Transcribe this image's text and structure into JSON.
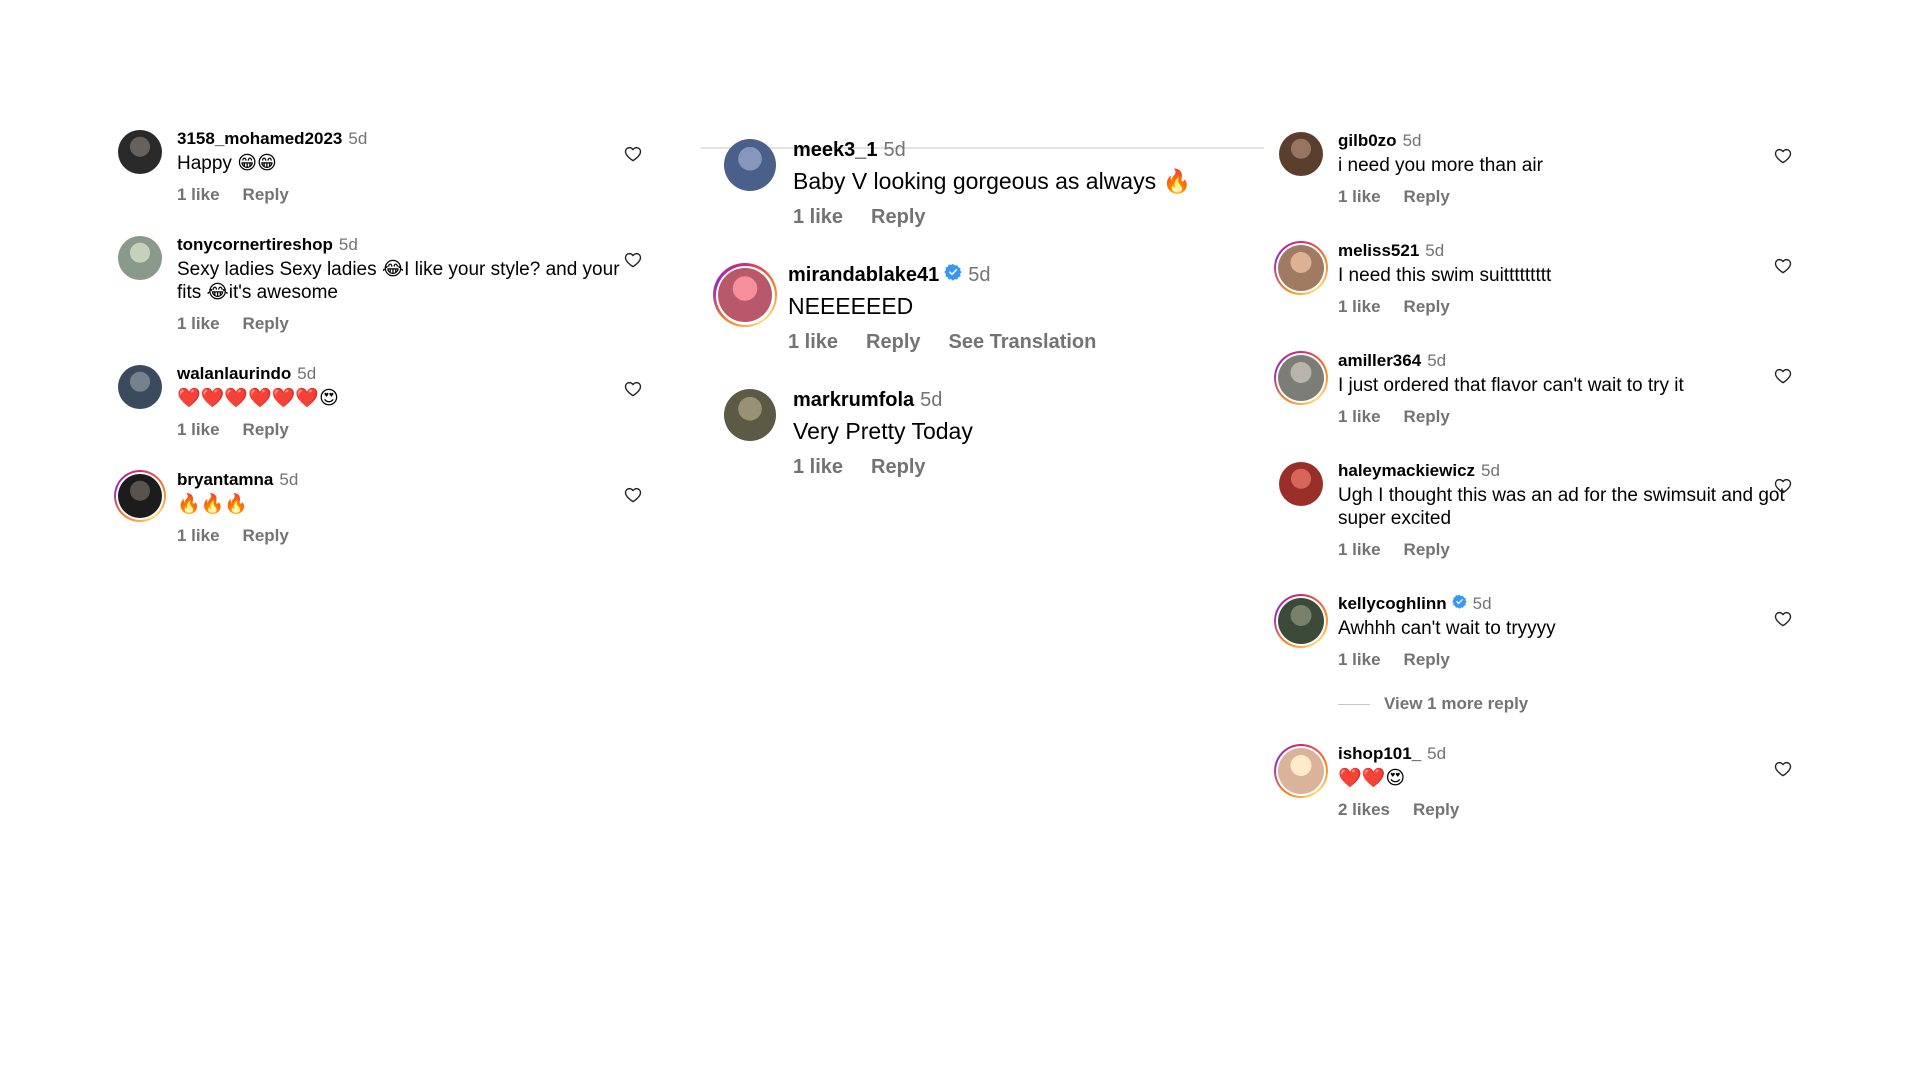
{
  "columns": [
    {
      "comments": [
        {
          "user": "3158_mohamed2023",
          "time": "5d",
          "text": "Happy 😁😁",
          "likes": "1 like",
          "reply": "Reply",
          "verified": false,
          "story": false,
          "avatar_color": "#2a2a2a"
        },
        {
          "user": "tonycornertireshop",
          "time": "5d",
          "text": "Sexy ladies Sexy ladies 😂I like your style? and your fits 😂it's awesome",
          "likes": "1 like",
          "reply": "Reply",
          "verified": false,
          "story": false,
          "avatar_color": "#8a9a8a"
        },
        {
          "user": "walanlaurindo",
          "time": "5d",
          "text": "❤️❤️❤️❤️❤️❤️😍",
          "likes": "1 like",
          "reply": "Reply",
          "verified": false,
          "story": false,
          "avatar_color": "#3b4a5c"
        },
        {
          "user": "bryantamna",
          "time": "5d",
          "text": "🔥🔥🔥",
          "likes": "1 like",
          "reply": "Reply",
          "verified": false,
          "story": true,
          "avatar_color": "#1c1c1c"
        }
      ]
    },
    {
      "comments": [
        {
          "user": "meek3_1",
          "time": "5d",
          "text": "Baby V looking gorgeous as always 🔥",
          "likes": "1 like",
          "reply": "Reply",
          "verified": false,
          "story": false,
          "avatar_color": "#4a5f8a"
        },
        {
          "user": "mirandablake41",
          "time": "5d",
          "text": "NEEEEEED",
          "likes": "1 like",
          "reply": "Reply",
          "translate": "See Translation",
          "verified": true,
          "story": true,
          "avatar_color": "#b9586a"
        },
        {
          "user": "markrumfola",
          "time": "5d",
          "text": "Very Pretty Today",
          "likes": "1 like",
          "reply": "Reply",
          "verified": false,
          "story": false,
          "avatar_color": "#5c5a44"
        }
      ]
    },
    {
      "comments": [
        {
          "user": "gilb0zo",
          "time": "5d",
          "text": "i need you more than air",
          "likes": "1 like",
          "reply": "Reply",
          "verified": false,
          "story": false,
          "avatar_color": "#5a3f2e"
        },
        {
          "user": "meliss521",
          "time": "5d",
          "text": "I need this swim suittttttttt",
          "likes": "1 like",
          "reply": "Reply",
          "verified": false,
          "story": true,
          "avatar_color": "#a07a62"
        },
        {
          "user": "amiller364",
          "time": "5d",
          "text": "I just ordered that flavor can't wait to try it",
          "likes": "1 like",
          "reply": "Reply",
          "verified": false,
          "story": true,
          "avatar_color": "#7d7d78"
        },
        {
          "user": "haleymackiewicz",
          "time": "5d",
          "text": "Ugh I thought this was an ad for the swimsuit and got super excited",
          "likes": "1 like",
          "reply": "Reply",
          "verified": false,
          "story": false,
          "avatar_color": "#9a2f2a"
        },
        {
          "user": "kellycoghlinn",
          "time": "5d",
          "text": "Awhhh can't wait to tryyyy",
          "likes": "1 like",
          "reply": "Reply",
          "verified": true,
          "story": true,
          "avatar_color": "#3c4a3a",
          "view_more": "View 1 more reply"
        },
        {
          "user": "ishop101_",
          "time": "5d",
          "text": "❤️❤️😍",
          "likes": "2 likes",
          "reply": "Reply",
          "verified": false,
          "story": true,
          "avatar_color": "#d9b39a"
        }
      ]
    }
  ],
  "colors": {
    "text": "#000000",
    "secondary": "#737373",
    "divider": "#e3e3e3",
    "verified": "#3897f0"
  }
}
